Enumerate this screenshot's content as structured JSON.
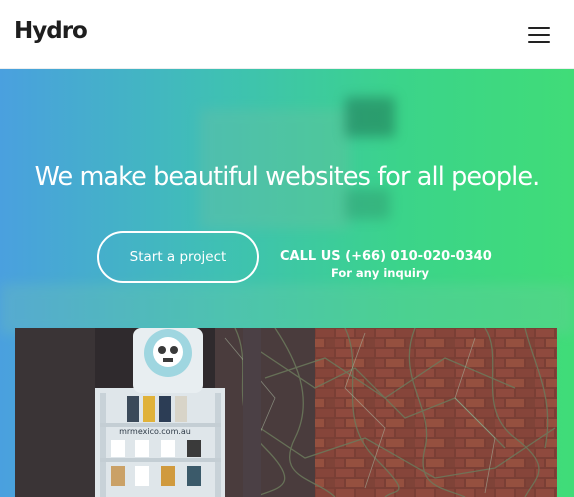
{
  "brand": {
    "name": "Hydro"
  },
  "hero": {
    "headline": "We make beautiful websites for all people.",
    "cta_label": "Start a project",
    "call_label": "CALL US (+66) 010-020-0340",
    "call_sub": "For any inquiry"
  },
  "photo": {
    "sign_text": "mrmexico.com.au"
  },
  "colors": {
    "gradient_left": "#4aa0df",
    "gradient_right": "#40dc78",
    "text": "#ffffff",
    "brand": "#1e1e1e"
  },
  "icons": {
    "menu": "hamburger-menu-icon"
  }
}
